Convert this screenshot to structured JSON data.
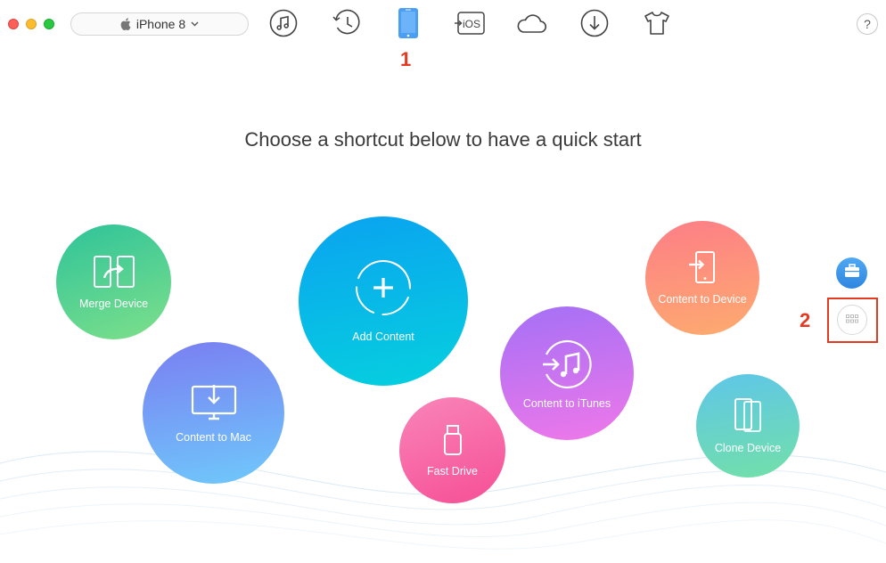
{
  "device": {
    "name": "iPhone 8"
  },
  "toolbar": {
    "tools": [
      {
        "name": "music"
      },
      {
        "name": "history"
      },
      {
        "name": "device",
        "active": true
      },
      {
        "name": "ios-mover",
        "text": "iOS"
      },
      {
        "name": "icloud"
      },
      {
        "name": "download"
      },
      {
        "name": "tshirt"
      }
    ],
    "help_label": "?"
  },
  "annotations": {
    "one": "1",
    "two": "2"
  },
  "headline": "Choose a shortcut below to have a quick start",
  "shortcuts": {
    "merge_device": "Merge Device",
    "content_to_mac": "Content to Mac",
    "add_content": "Add Content",
    "fast_drive": "Fast Drive",
    "content_to_itunes": "Content to iTunes",
    "content_to_device": "Content to Device",
    "clone_device": "Clone Device"
  },
  "colors": {
    "accent_red": "#e33a22",
    "active_blue": "#4a9ff5"
  }
}
